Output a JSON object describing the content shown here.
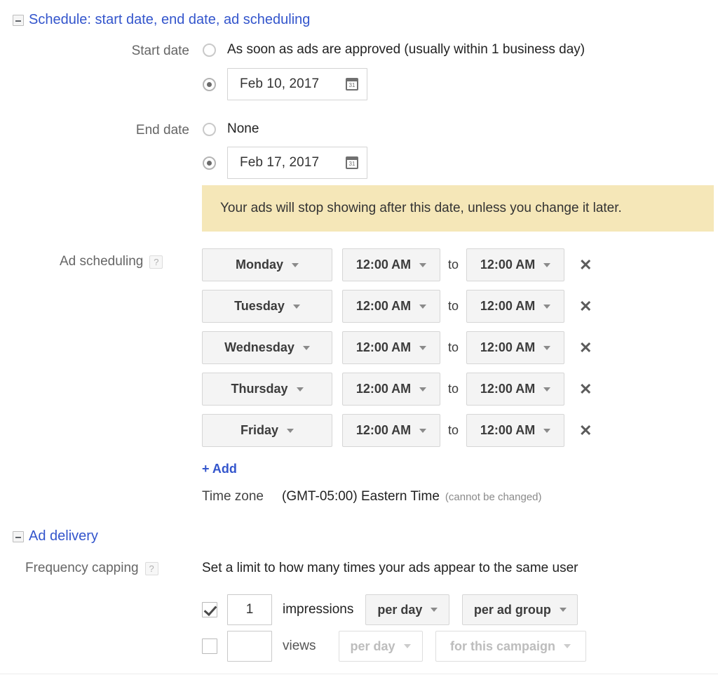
{
  "schedule_section": {
    "title": "Schedule: start date, end date, ad scheduling",
    "toggle_icon": "collapse-minus-icon",
    "start_date": {
      "label": "Start date",
      "option_asap": "As soon as ads are approved (usually within 1 business day)",
      "option_asap_selected": false,
      "option_date_selected": true,
      "date_value": "Feb 10, 2017",
      "calendar_icon": "calendar-icon"
    },
    "end_date": {
      "label": "End date",
      "option_none": "None",
      "option_none_selected": false,
      "option_date_selected": true,
      "date_value": "Feb 17, 2017",
      "calendar_icon": "calendar-icon"
    },
    "notice": {
      "text": "Your ads will stop showing after this date, unless you change it later.",
      "background": "#f5e7b8"
    },
    "ad_scheduling": {
      "label": "Ad scheduling",
      "help_icon": "help-question-icon",
      "to_label": "to",
      "remove_icon": "close-x-icon",
      "rows": [
        {
          "day": "Monday",
          "start_time": "12:00 AM",
          "end_time": "12:00 AM"
        },
        {
          "day": "Tuesday",
          "start_time": "12:00 AM",
          "end_time": "12:00 AM"
        },
        {
          "day": "Wednesday",
          "start_time": "12:00 AM",
          "end_time": "12:00 AM"
        },
        {
          "day": "Thursday",
          "start_time": "12:00 AM",
          "end_time": "12:00 AM"
        },
        {
          "day": "Friday",
          "start_time": "12:00 AM",
          "end_time": "12:00 AM"
        }
      ],
      "add_link": "+ Add",
      "timezone_label": "Time zone",
      "timezone_value": "(GMT-05:00) Eastern Time",
      "timezone_note": "(cannot be changed)"
    }
  },
  "ad_delivery_section": {
    "title": "Ad delivery",
    "toggle_icon": "collapse-minus-icon",
    "frequency_capping": {
      "label": "Frequency capping",
      "help_icon": "help-question-icon",
      "description": "Set a limit to how many times your ads appear to the same user",
      "rows": [
        {
          "checked": true,
          "amount": "1",
          "unit": "impressions",
          "period": "per day",
          "scope": "per ad group"
        },
        {
          "checked": false,
          "amount": "",
          "unit": "views",
          "period": "per day",
          "scope": "for this campaign"
        }
      ]
    }
  },
  "colors": {
    "link": "#3355cc",
    "notice_bg": "#f5e7b8",
    "label_gray": "#666666",
    "button_bg": "#f4f4f4"
  }
}
